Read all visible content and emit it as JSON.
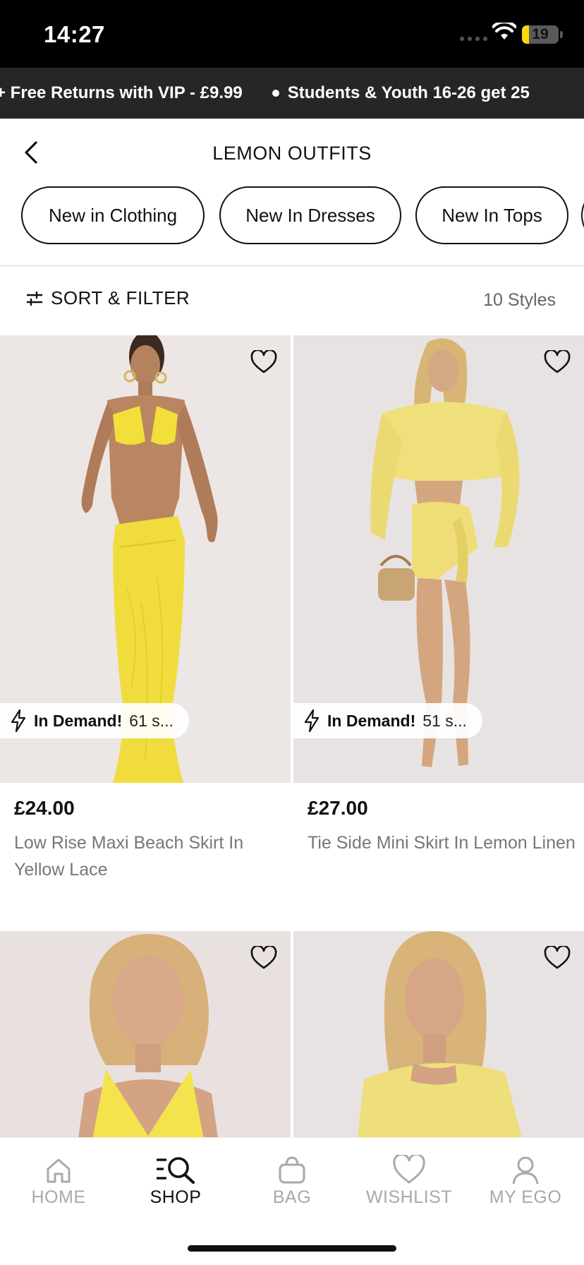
{
  "status_bar": {
    "time": "14:27",
    "battery": "19",
    "battery_level": 0.19
  },
  "promo_banner": {
    "items": [
      "+ Free Returns with VIP - £9.99",
      "Students & Youth 16-26 get 25"
    ]
  },
  "header": {
    "title": "LEMON OUTFITS",
    "back_icon": "chevron-left-icon"
  },
  "chips": [
    "New in Clothing",
    "New In Dresses",
    "New In Tops"
  ],
  "sort_bar": {
    "label": "SORT & FILTER",
    "count": "10 Styles",
    "icon": "sliders-icon"
  },
  "products": [
    {
      "price": "£24.00",
      "name": "Low Rise Maxi Beach Skirt In Yellow Lace",
      "badge_bold": "In Demand!",
      "badge_rest": "61 s..."
    },
    {
      "price": "£27.00",
      "name": "Tie Side Mini Skirt In Lemon Linen",
      "badge_bold": "In Demand!",
      "badge_rest": "51 s..."
    },
    {
      "price": "",
      "name": ""
    },
    {
      "price": "",
      "name": ""
    }
  ],
  "tabbar": {
    "items": [
      {
        "label": "HOME",
        "icon": "home-icon",
        "active": false
      },
      {
        "label": "SHOP",
        "icon": "search-icon",
        "active": true
      },
      {
        "label": "BAG",
        "icon": "bag-icon",
        "active": false
      },
      {
        "label": "WISHLIST",
        "icon": "heart-icon",
        "active": false
      },
      {
        "label": "MY EGO",
        "icon": "user-icon",
        "active": false
      }
    ]
  },
  "colors": {
    "accent": "#111111",
    "promo_bg": "#262626",
    "lemon": "#f3df5a",
    "muted": "#a9a9a9"
  }
}
